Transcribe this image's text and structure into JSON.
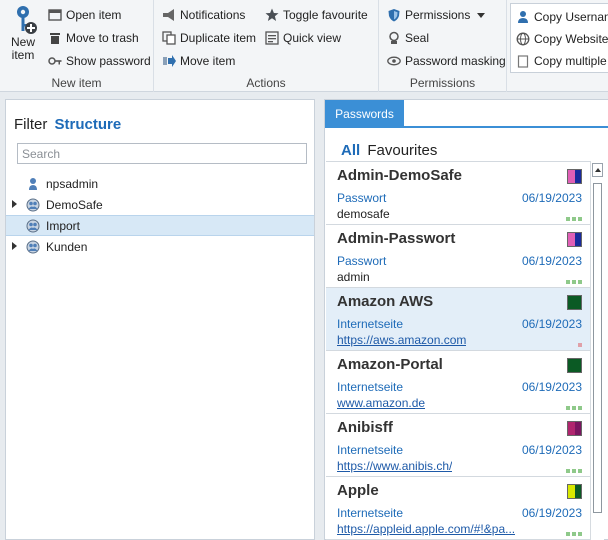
{
  "ribbon": {
    "new_item": {
      "label": "New item",
      "group_label": "New item"
    },
    "new_group": {
      "open_item": "Open item",
      "move_to_trash": "Move to trash",
      "show_password": "Show password"
    },
    "actions": {
      "group_label": "Actions",
      "notifications": "Notifications",
      "duplicate_item": "Duplicate item",
      "move_item": "Move item",
      "toggle_favourite": "Toggle favourite",
      "quick_view": "Quick view"
    },
    "permissions": {
      "group_label": "Permissions",
      "permissions": "Permissions",
      "seal": "Seal",
      "password_masking": "Password masking"
    },
    "copy": {
      "copy_username": "Copy Usernam",
      "copy_website": "Copy Website",
      "copy_multiple": "Copy multiple"
    }
  },
  "filter": {
    "title": "Filter",
    "mode": "Structure",
    "search_placeholder": "Search",
    "tree": [
      {
        "label": "npsadmin",
        "expandable": false,
        "selected": false
      },
      {
        "label": "DemoSafe",
        "expandable": true,
        "selected": false
      },
      {
        "label": "Import",
        "expandable": false,
        "selected": true
      },
      {
        "label": "Kunden",
        "expandable": true,
        "selected": false
      }
    ]
  },
  "passwords": {
    "tab": "Passwords",
    "sub_all": "All",
    "sub_favourites": "Favourites",
    "items": [
      {
        "title": "Admin-DemoSafe",
        "type": "Passwort",
        "date": "06/19/2023",
        "value": "demosafe",
        "link": false,
        "colors": [
          "#e05fb6",
          "#1a2a9c"
        ],
        "selected": false,
        "dots": [
          "g",
          "g",
          "g"
        ]
      },
      {
        "title": "Admin-Passwort",
        "type": "Passwort",
        "date": "06/19/2023",
        "value": "admin",
        "link": false,
        "colors": [
          "#e05fb6",
          "#1a2a9c"
        ],
        "selected": false,
        "dots": [
          "g",
          "g",
          "g"
        ]
      },
      {
        "title": "Amazon AWS",
        "type": "Internetseite",
        "date": "06/19/2023",
        "value": "https://aws.amazon.com",
        "link": true,
        "colors": [
          "#0b5a24"
        ],
        "selected": true,
        "dots": [
          "r"
        ]
      },
      {
        "title": "Amazon-Portal",
        "type": "Internetseite",
        "date": "06/19/2023",
        "value": "www.amazon.de",
        "link": true,
        "colors": [
          "#0b5a24"
        ],
        "selected": false,
        "dots": [
          "g",
          "g",
          "g"
        ]
      },
      {
        "title": "Anibisff",
        "type": "Internetseite",
        "date": "06/19/2023",
        "value": "https://www.anibis.ch/",
        "link": true,
        "colors": [
          "#b0256e",
          "#7a1560"
        ],
        "selected": false,
        "dots": [
          "g",
          "g",
          "g"
        ]
      },
      {
        "title": "Apple",
        "type": "Internetseite",
        "date": "06/19/2023",
        "value": "https://appleid.apple.com/#!&pa...",
        "link": true,
        "colors": [
          "#d8e800",
          "#0b5a24"
        ],
        "selected": false,
        "dots": [
          "g",
          "g",
          "g"
        ]
      }
    ]
  },
  "colors": {
    "accent": "#1e6bb8",
    "tab_blue": "#3b8fd6",
    "selection": "#d7e8f6"
  }
}
